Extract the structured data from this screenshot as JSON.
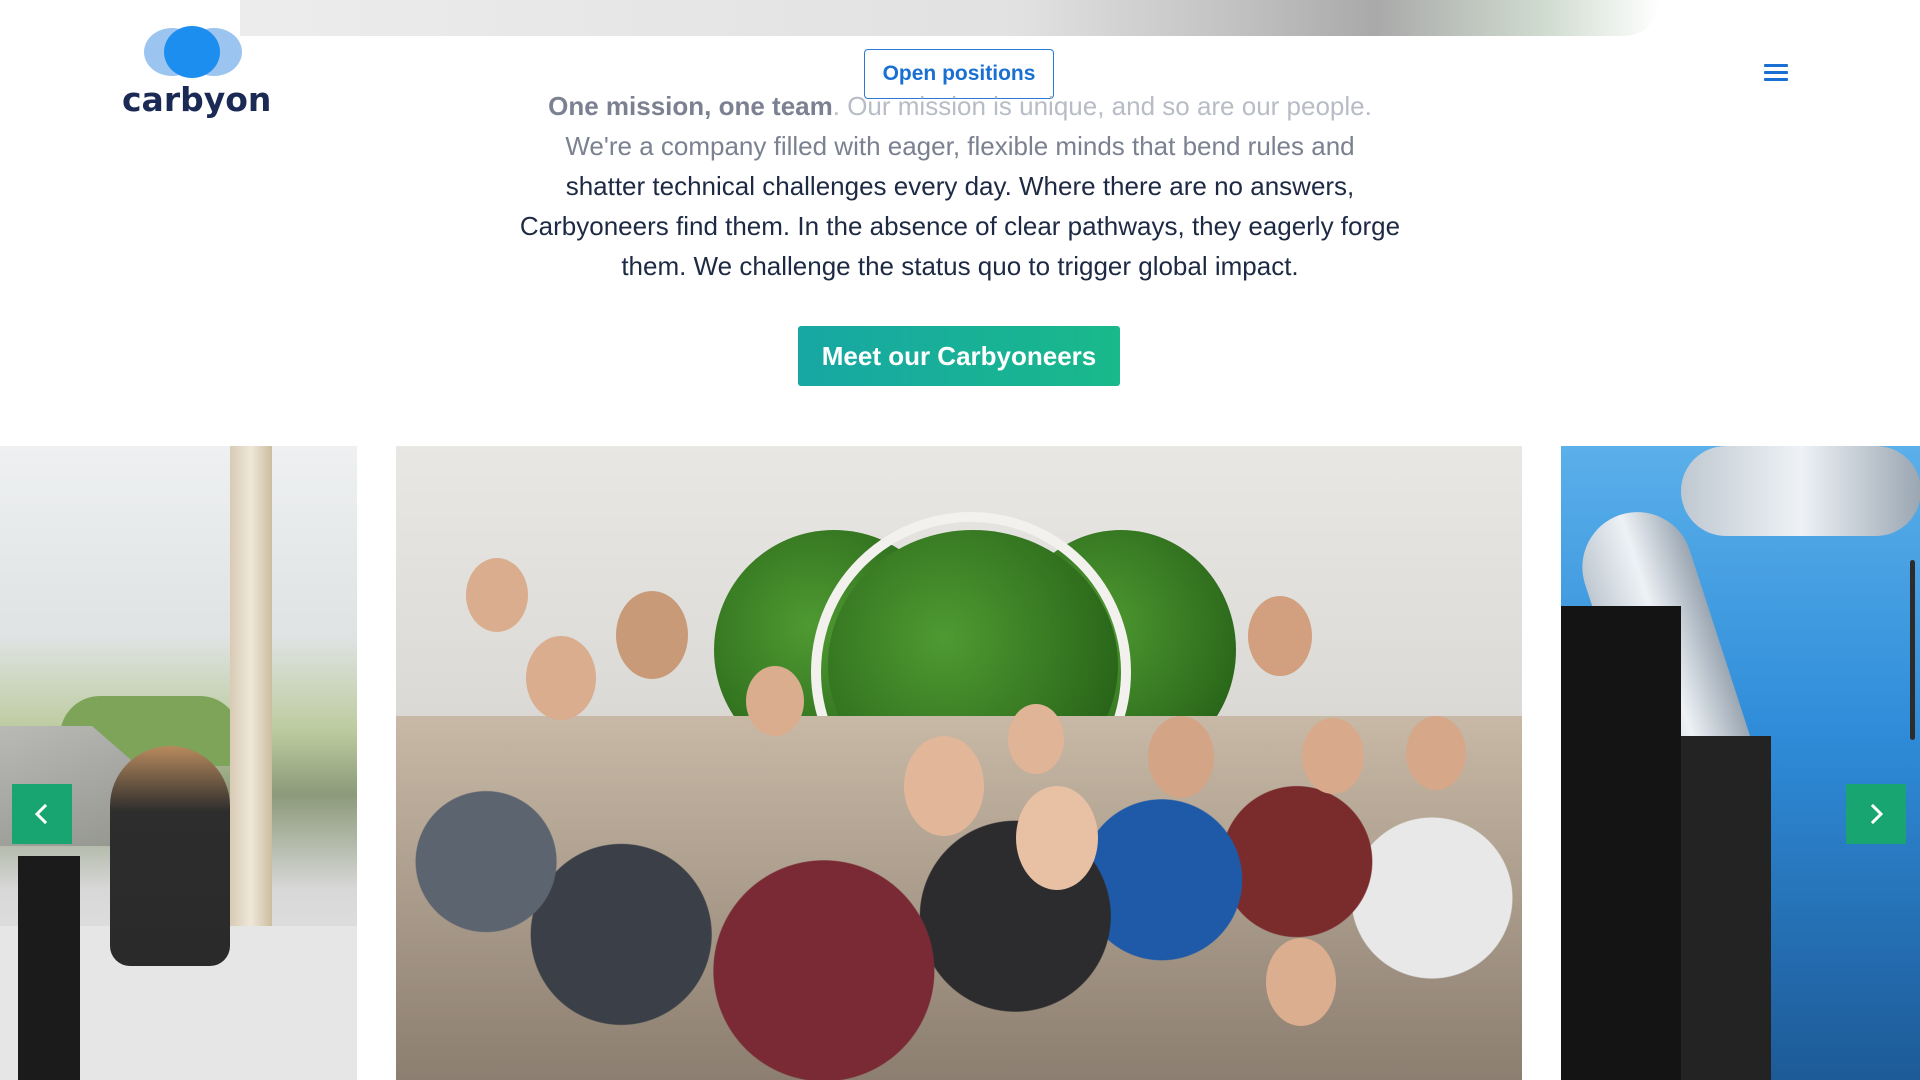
{
  "header": {
    "logo_text": "carbyon",
    "open_positions_label": "Open positions",
    "menu_icon": "hamburger-menu-icon"
  },
  "mission": {
    "lead": "One mission, one team",
    "text_faded": ". Our mission is unique, and so are our people.",
    "text_line2": "We're a company filled with eager, flexible minds that bend rules and",
    "text_rest": "shatter technical challenges every day. Where there are no answers, Carbyoneers find them. In the absence of clear pathways, they eagerly forge them. We challenge the status quo to trigger global impact."
  },
  "cta": {
    "label": "Meet our Carbyoneers"
  },
  "carousel": {
    "prev_icon": "chevron-left-icon",
    "next_icon": "chevron-right-icon"
  },
  "colors": {
    "brand_blue": "#1c8ef0",
    "accent_green": "#18a571",
    "cta_gradient_start": "#17a7a4",
    "cta_gradient_end": "#19b98b",
    "text_dark": "#1e2a44"
  }
}
